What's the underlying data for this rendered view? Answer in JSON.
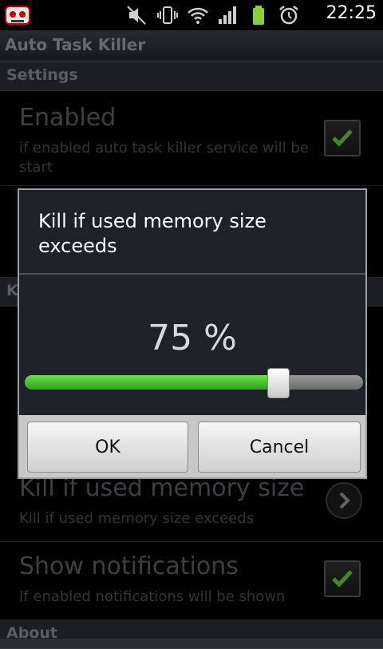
{
  "status_bar": {
    "time": "22:25"
  },
  "app_title": "Auto Task Killer",
  "settings_section": "Settings",
  "enabled_pref": {
    "title": "Enabled",
    "summary": "if enabled auto task killer service will be start",
    "checked": true
  },
  "kill_section_initial": "K",
  "memory_pref": {
    "title": "Kill if used memory size",
    "summary": "Kill if used memory size exceeds"
  },
  "notifications_pref": {
    "title": "Show notifications",
    "summary": "If enabled notifications will be shown",
    "checked": true
  },
  "about_section": "About",
  "dialog": {
    "title": "Kill if used memory size exceeds",
    "value_text": "75 %",
    "slider_value": 75,
    "ok_label": "OK",
    "cancel_label": "Cancel"
  },
  "colors": {
    "accent_green": "#2fae1f",
    "check_green": "#6ccf3a",
    "background": "#000000"
  }
}
